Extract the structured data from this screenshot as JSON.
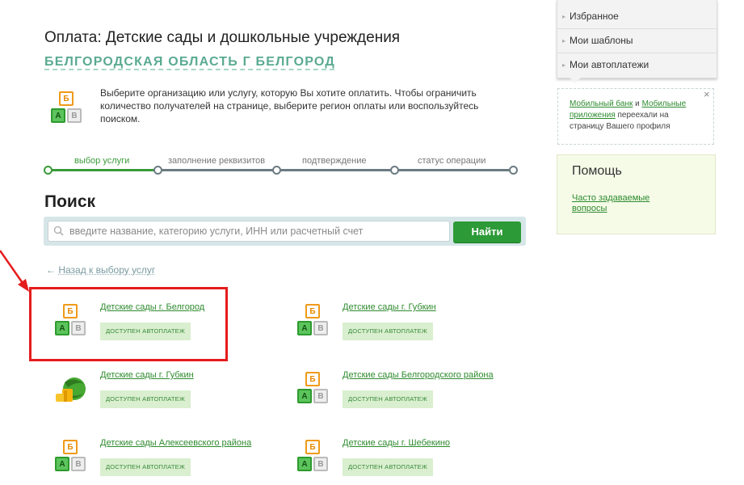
{
  "header": {
    "title": "Оплата: Детские сады и дошкольные учреждения",
    "region": "БЕЛГОРОДСКАЯ ОБЛАСТЬ Г БЕЛГОРОД",
    "intro": "Выберите организацию или услугу, которую Вы хотите оплатить. Чтобы ограничить количество получателей на странице, выберите регион оплаты или воспользуйтесь поиском."
  },
  "icon_letters": {
    "top": "Б",
    "left": "А",
    "right": "В"
  },
  "steps": [
    {
      "label": "выбор услуги",
      "active": true
    },
    {
      "label": "заполнение реквизитов",
      "active": false
    },
    {
      "label": "подтверждение",
      "active": false
    },
    {
      "label": "статус операции",
      "active": false
    }
  ],
  "search": {
    "title": "Поиск",
    "placeholder": "введите название, категорию услуги, ИНН или расчетный счет",
    "button": "Найти"
  },
  "back_link": {
    "arrow": "←",
    "label": "Назад к выбору услуг"
  },
  "providers": [
    {
      "name": "Детские сады г. Белгород",
      "badge": "ДОСТУПЕН АВТОПЛАТЕЖ",
      "icon": "abv-blocks-icon",
      "highlighted": true
    },
    {
      "name": "Детские сады г. Губкин",
      "badge": "ДОСТУПЕН АВТОПЛАТЕЖ",
      "icon": "abv-blocks-icon"
    },
    {
      "name": "Детские сады г. Губкин",
      "badge": "ДОСТУПЕН АВТОПЛАТЕЖ",
      "icon": "golden-ball-icon"
    },
    {
      "name": "Детские сады Белгородского района",
      "badge": "ДОСТУПЕН АВТОПЛАТЕЖ",
      "icon": "abv-blocks-icon"
    },
    {
      "name": "Детские сады Алексеевского района",
      "badge": "ДОСТУПЕН АВТОПЛАТЕЖ",
      "icon": "abv-blocks-icon"
    },
    {
      "name": "Детские сады г. Шебекино",
      "badge": "ДОСТУПЕН АВТОПЛАТЕЖ",
      "icon": "abv-blocks-icon"
    }
  ],
  "sidebar": {
    "menu": [
      {
        "label": "Избранное",
        "icon": "arrow-right-icon"
      },
      {
        "label": "Мои шаблоны",
        "icon": "arrow-right-icon"
      },
      {
        "label": "Мои автоплатежи",
        "icon": "arrow-right-icon"
      }
    ],
    "menu_arrow": "▸",
    "promo": {
      "link1": "Мобильный банк",
      "and": " и ",
      "link2": "Мобильные приложения",
      "rest": " переехали на страницу Вашего профиля",
      "close": "×"
    },
    "help": {
      "title": "Помощь",
      "link": "Часто задаваемые вопросы"
    }
  },
  "colors": {
    "accent_green": "#2c9a37",
    "link_green": "#2e8b2e",
    "highlight_red": "#e51c1c",
    "region_teal": "#5aaa91"
  }
}
